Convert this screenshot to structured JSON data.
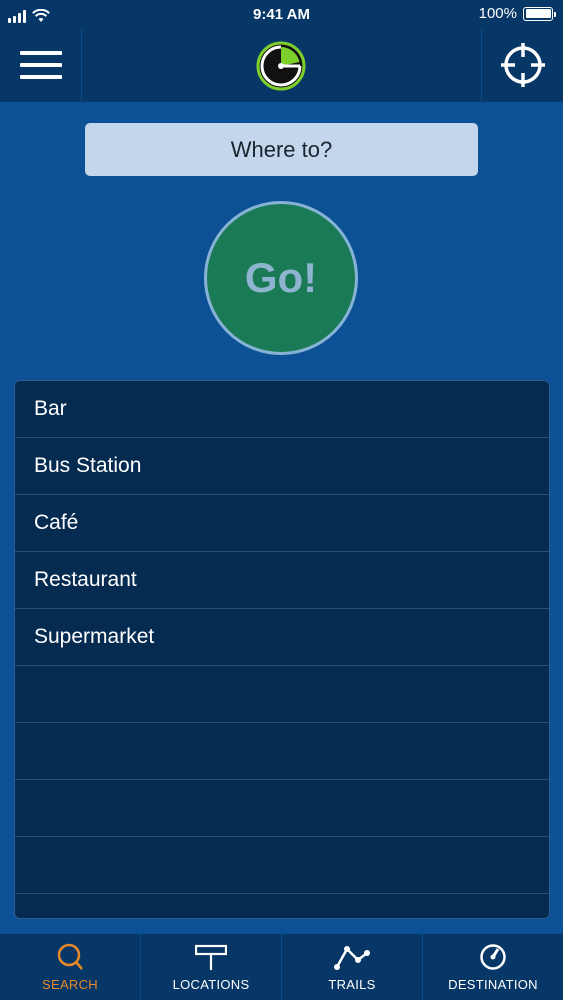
{
  "status_bar": {
    "time": "9:41 AM",
    "battery_text": "100%",
    "battery_level": 1.0
  },
  "nav": {
    "menu_icon": "hamburger-menu-icon",
    "logo_icon": "radar-logo-icon",
    "locate_icon": "crosshair-icon"
  },
  "search": {
    "placeholder": "Where to?"
  },
  "go_button": {
    "label": "Go!"
  },
  "list": {
    "items": [
      "Bar",
      "Bus Station",
      "Café",
      "Restaurant",
      "Supermarket",
      "",
      "",
      "",
      "",
      ""
    ]
  },
  "tabs": [
    {
      "label": "SEARCH",
      "icon": "search-icon",
      "active": true
    },
    {
      "label": "LOCATIONS",
      "icon": "signpost-icon",
      "active": false
    },
    {
      "label": "TRAILS",
      "icon": "trail-icon",
      "active": false
    },
    {
      "label": "DESTINATION",
      "icon": "compass-icon",
      "active": false
    }
  ],
  "colors": {
    "background": "#0c5195",
    "bar": "#073766",
    "accent": "#e8892b",
    "go_green": "#1a7a55",
    "list_bg": "#062b51"
  }
}
